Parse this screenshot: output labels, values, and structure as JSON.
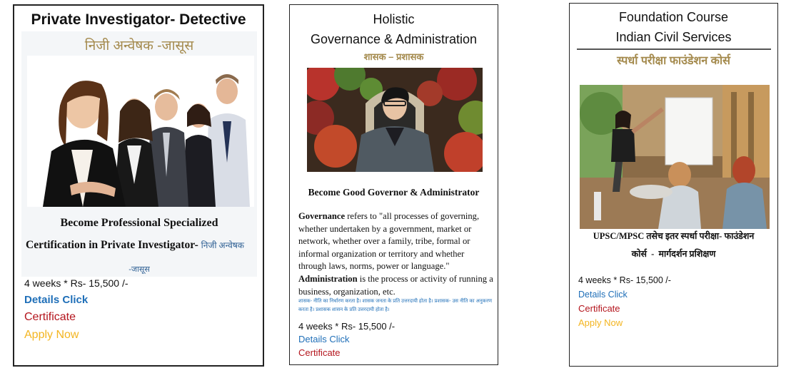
{
  "cards": [
    {
      "title": "Private Investigator- Detective",
      "subtitle": "निजी अन्वेषक -जासूस",
      "tagline1": "Become Professional Specialized",
      "tagline2": "Certification in Private Investigator-",
      "tagline2_hindi": "निजी अन्वेषक",
      "tagline3_hindi": "-जासूस",
      "duration_price": "4 weeks * Rs- 15,500 /-",
      "details_label": "Details Click",
      "certificate_label": "Certificate",
      "apply_label": "Apply Now"
    },
    {
      "title_line1": "Holistic",
      "title_line2": "Governance & Administration",
      "subtitle": "शासक – प्रशासक",
      "tagline": "Become Good Governor & Administrator",
      "desc_bold1": "Governance",
      "desc_text1": " refers to \"all processes of governing, whether undertaken by a government, market or network, whether over a family, tribe, formal or informal organization or territory and whether through laws, norms, power or language.\" ",
      "desc_bold2": "Administration",
      "desc_text2": " is the process or activity of running a business, organization, etc.",
      "hindi_note": "शासक- नीति का निर्धारण करता है। शासक जनता के प्रति उत्तरदायी होता है। प्रशासक- उस नीति का अनुकरण करता है। प्रशासक शासन के प्रति उत्तरदायी होता है।",
      "duration_price": "4 weeks * Rs- 15,500 /-",
      "details_label": "Details Click",
      "certificate_label": "Certificate"
    },
    {
      "title_line1": "Foundation Course",
      "title_line2": "Indian Civil Services",
      "subtitle": "स्पर्धा परीक्षा फाउंडेशन कोर्स",
      "tagline1": "UPSC/MPSC तसेच इतर स्पर्धा परीक्षा- फाउंडेशन",
      "tagline2": "कोर्स  -  मार्गदर्शन प्रशिक्षण",
      "duration_price": "4 weeks * Rs- 15,500 /-",
      "details_label": "Details Click",
      "certificate_label": "Certificate",
      "apply_label": "Apply Now"
    }
  ],
  "colors": {
    "link_blue": "#1f6fb8",
    "certificate_red": "#b4151d",
    "apply_gold": "#f3b521",
    "hindi_gold": "#a48a4d"
  }
}
